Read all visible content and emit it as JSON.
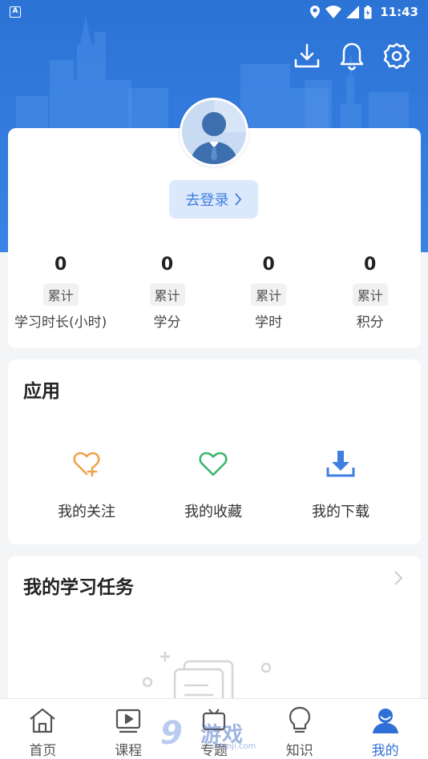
{
  "status_bar": {
    "badge": "A",
    "time": "11:43"
  },
  "header": {
    "icons": [
      "download-icon",
      "bell-icon",
      "settings-icon"
    ]
  },
  "profile": {
    "login_label": "去登录",
    "stats": [
      {
        "value": "0",
        "tag": "累计",
        "label": "学习时长(小时)"
      },
      {
        "value": "0",
        "tag": "累计",
        "label": "学分"
      },
      {
        "value": "0",
        "tag": "累计",
        "label": "学时"
      },
      {
        "value": "0",
        "tag": "累计",
        "label": "积分"
      }
    ]
  },
  "apps": {
    "title": "应用",
    "items": [
      {
        "label": "我的关注",
        "icon": "heart-plus-icon",
        "color": "#f0a24a"
      },
      {
        "label": "我的收藏",
        "icon": "heart-icon",
        "color": "#3bb86b"
      },
      {
        "label": "我的下载",
        "icon": "download-tray-icon",
        "color": "#3f7fe0"
      }
    ]
  },
  "tasks": {
    "title": "我的学习任务"
  },
  "bottom_nav": {
    "items": [
      {
        "label": "首页",
        "icon": "home-icon",
        "active": false
      },
      {
        "label": "课程",
        "icon": "video-icon",
        "active": false
      },
      {
        "label": "专题",
        "icon": "topic-icon",
        "active": false
      },
      {
        "label": "知识",
        "icon": "lightbulb-icon",
        "active": false
      },
      {
        "label": "我的",
        "icon": "user-icon",
        "active": true
      }
    ]
  },
  "watermark": {
    "num": "9",
    "text": "游戏",
    "sub": "9danji.com"
  },
  "colors": {
    "header_blue": "#2c73d6",
    "accent": "#2f6fd6",
    "login_bg": "#dce8fb"
  }
}
